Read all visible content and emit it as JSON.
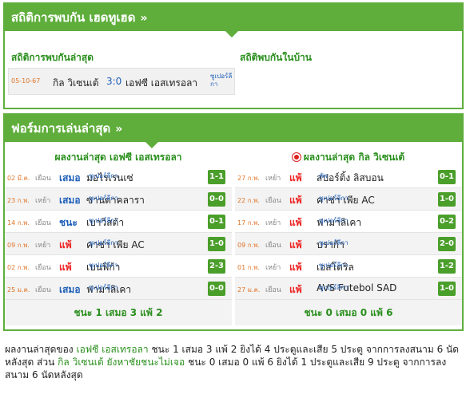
{
  "h2h": {
    "title": "สถิติการพบกัน เฮดทูเฮด",
    "chevron": "»",
    "recent_label": "สถิติการพบกันล่าสุด",
    "home_label": "สถิติพบกันในบ้าน",
    "match": {
      "date": "05-10-67",
      "home": "กิล วิเซนเต้",
      "score": "3:0",
      "away": "เอฟซี เอสเทรอลา",
      "league": "ซูเปอร์ลีกา"
    }
  },
  "form": {
    "title": "ฟอร์มการเล่นล่าสุด",
    "chevron": "»",
    "left": {
      "title": "ผลงานล่าสุด เอฟซี เอสเทรอลา",
      "rows": [
        {
          "date": "02 มี.ค.",
          "ha": "เยือน",
          "res": "เสมอ",
          "opp": "มอไรเรนเซ่",
          "league": "ซูเปอร์ลีกา",
          "score": "1-1"
        },
        {
          "date": "23 ก.พ.",
          "ha": "เหย้า",
          "res": "เสมอ",
          "opp": "ซานตาคลารา",
          "league": "ซูเปอร์ลีกา",
          "score": "0-0"
        },
        {
          "date": "14 ก.พ.",
          "ha": "เยือน",
          "res": "ชนะ",
          "opp": "เบาวิสต้า",
          "league": "ซูเปอร์ลีกา",
          "score": "0-1"
        },
        {
          "date": "09 ก.พ.",
          "ha": "เหย้า",
          "res": "แพ้",
          "opp": "คาซ่า เพีย AC",
          "league": "ซูเปอร์ลีกา",
          "score": "1-0"
        },
        {
          "date": "02 ก.พ.",
          "ha": "เยือน",
          "res": "แพ้",
          "opp": "เบนฟิก้า",
          "league": "ซูเปอร์ลีกา",
          "score": "2-3"
        },
        {
          "date": "25 ม.ค.",
          "ha": "เยือน",
          "res": "เสมอ",
          "opp": "ฟามาลิเคา",
          "league": "ซูเปอร์ลีกา",
          "score": "0-0"
        }
      ],
      "summary": "ชนะ 1 เสมอ 3 แพ้ 2"
    },
    "right": {
      "title": "ผลงานล่าสุด กิล วิเซนเต้",
      "rows": [
        {
          "date": "27 ก.พ.",
          "ha": "เหย้า",
          "res": "แพ้",
          "opp": "สปอร์ติ้ง ลิสบอน",
          "league": "คัพ",
          "score": "0-1"
        },
        {
          "date": "22 ก.พ.",
          "ha": "เยือน",
          "res": "แพ้",
          "opp": "คาซ่า เพีย AC",
          "league": "ซูเปอร์ลีกา",
          "score": "1-0"
        },
        {
          "date": "17 ก.พ.",
          "ha": "เหย้า",
          "res": "แพ้",
          "opp": "ฟามาลิเคา",
          "league": "ซูเปอร์ลีกา",
          "score": "0-2"
        },
        {
          "date": "09 ก.พ.",
          "ha": "เยือน",
          "res": "แพ้",
          "opp": "บราก้า",
          "league": "ซูเปอร์ลีกา",
          "score": "2-0"
        },
        {
          "date": "01 ก.พ.",
          "ha": "เหย้า",
          "res": "แพ้",
          "opp": "เอสโตริล",
          "league": "ซูเปอร์ลีกา",
          "score": "1-2"
        },
        {
          "date": "27 ม.ค.",
          "ha": "เยือน",
          "res": "แพ้",
          "opp": "AVS Futebol SAD",
          "league": "ซูเปอร์ลีกา",
          "score": "1-0"
        }
      ],
      "summary": "ชนะ 0 เสมอ 0 แพ้ 6"
    }
  },
  "narrative": {
    "p1": "ผลงานล่าสุดของ ",
    "team1": "เอฟซี เอสเทรอลา",
    "p2": " ชนะ 1 เสมอ 3 แพ้ 2 ยิงได้ 4 ประตูและเสีย 5 ประตู จากการลงสนาม 6 นัดหลังสุด ส่วน ",
    "team2": "กิล วิเซนเต้ ยังหาชัยชนะไม่เจอ",
    "p3": " ชนะ 0 เสมอ 0 แพ้ 6 ยิงได้ 1 ประตูและเสีย 9 ประตู จากการลงสนาม 6 นัดหลังสุด"
  }
}
